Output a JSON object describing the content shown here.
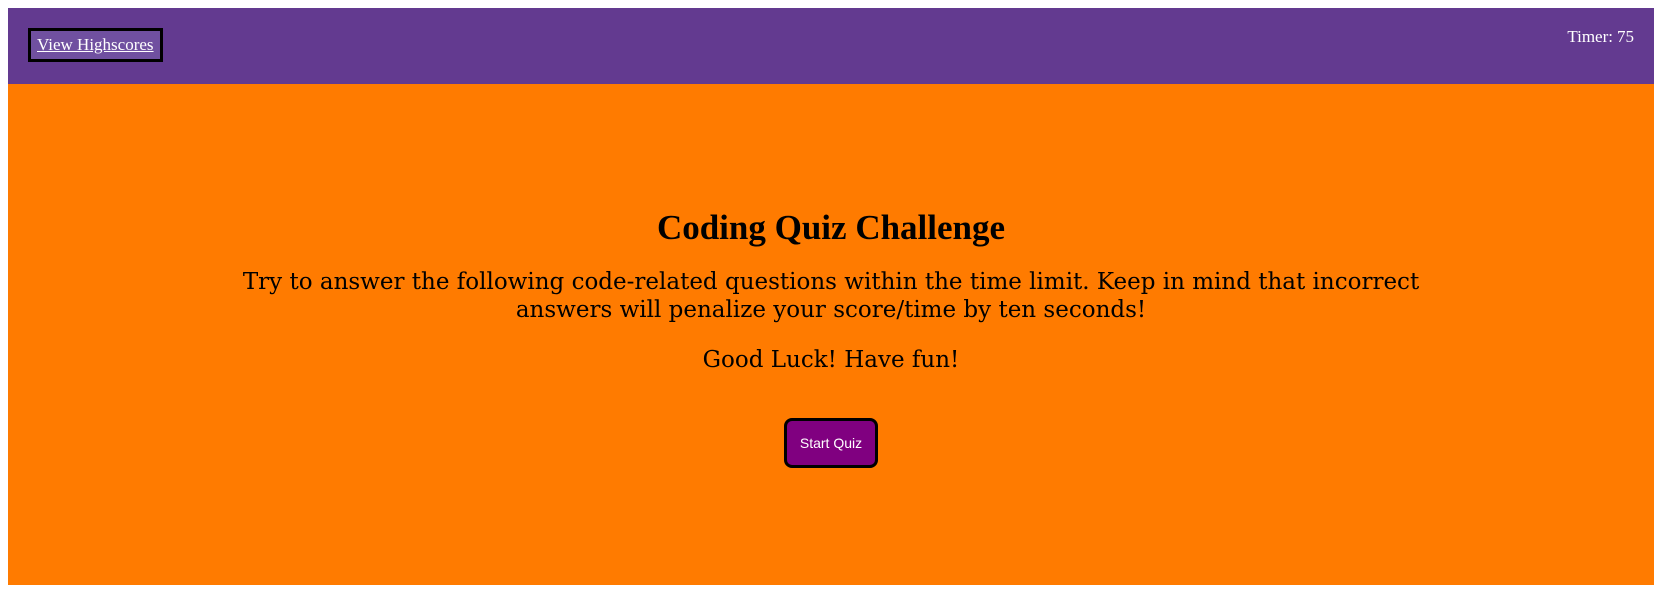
{
  "header": {
    "highscores_label": "View Highscores",
    "timer_label": "Timer:",
    "timer_value": "75"
  },
  "main": {
    "title": "Coding Quiz Challenge",
    "instructions": "Try to answer the following code-related questions within the time limit. Keep in mind that incorrect answers will penalize your score/time by ten seconds!",
    "good_luck": "Good Luck! Have fun!",
    "start_label": "Start Quiz"
  },
  "colors": {
    "page_background": "#ff7b00",
    "header_background": "#633a90",
    "start_button_background": "#800080",
    "border": "#000000",
    "header_text": "#ffffff"
  }
}
